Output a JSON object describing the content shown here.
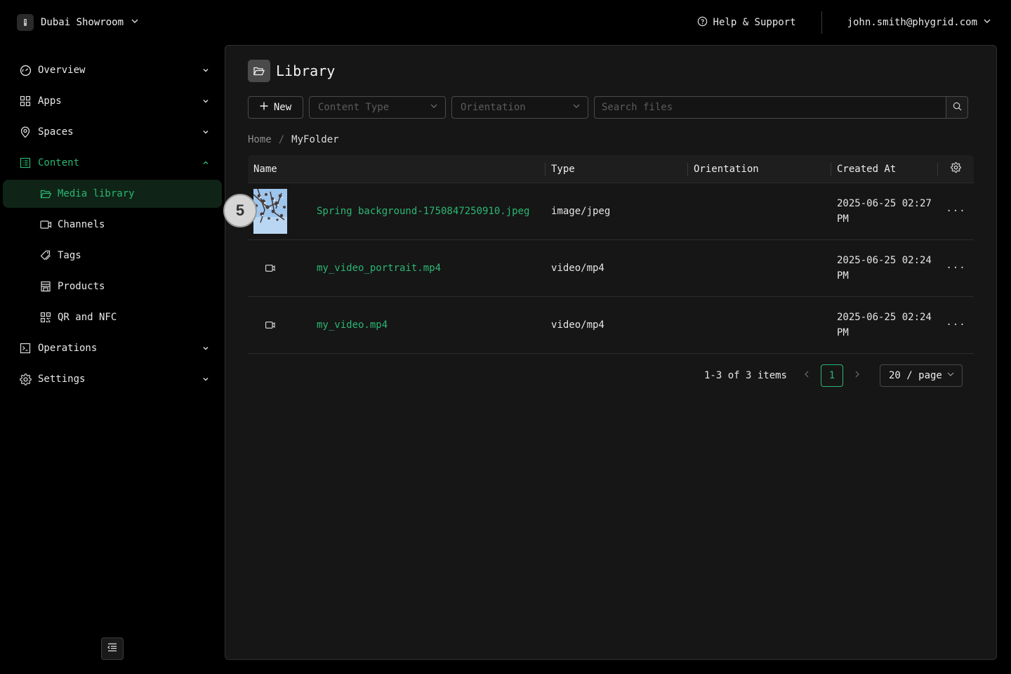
{
  "workspace": {
    "name": "Dubai Showroom"
  },
  "header": {
    "help_label": "Help & Support",
    "user_email": "john.smith@phygrid.com"
  },
  "sidebar": {
    "items": [
      {
        "label": "Overview"
      },
      {
        "label": "Apps"
      },
      {
        "label": "Spaces"
      },
      {
        "label": "Content"
      },
      {
        "label": "Operations"
      },
      {
        "label": "Settings"
      }
    ],
    "content_children": [
      {
        "label": "Media library"
      },
      {
        "label": "Channels"
      },
      {
        "label": "Tags"
      },
      {
        "label": "Products"
      },
      {
        "label": "QR and NFC"
      }
    ]
  },
  "page": {
    "title": "Library"
  },
  "toolbar": {
    "new_label": "New",
    "content_type_placeholder": "Content Type",
    "orientation_placeholder": "Orientation",
    "search_placeholder": "Search files"
  },
  "breadcrumb": {
    "home": "Home",
    "separator": "/",
    "current": "MyFolder"
  },
  "table": {
    "columns": {
      "name": "Name",
      "type": "Type",
      "orientation": "Orientation",
      "created": "Created At"
    },
    "rows": [
      {
        "name": "Spring background-1750847250910.jpeg",
        "type": "image/jpeg",
        "orientation": "",
        "created_line1": "2025-06-25 02:27",
        "created_line2": "PM",
        "actions": "···"
      },
      {
        "name": "my_video_portrait.mp4",
        "type": "video/mp4",
        "orientation": "",
        "created_line1": "2025-06-25 02:24",
        "created_line2": "PM",
        "actions": "···"
      },
      {
        "name": "my_video.mp4",
        "type": "video/mp4",
        "orientation": "",
        "created_line1": "2025-06-25 02:24",
        "created_line2": "PM",
        "actions": "···"
      }
    ]
  },
  "pagination": {
    "total_label": "1-3 of 3 items",
    "current_page": "1",
    "page_size": "20 / page"
  },
  "annotation": {
    "step_number": "5"
  },
  "colors": {
    "accent": "#2bb673",
    "background": "#000000",
    "panel": "#161616"
  }
}
